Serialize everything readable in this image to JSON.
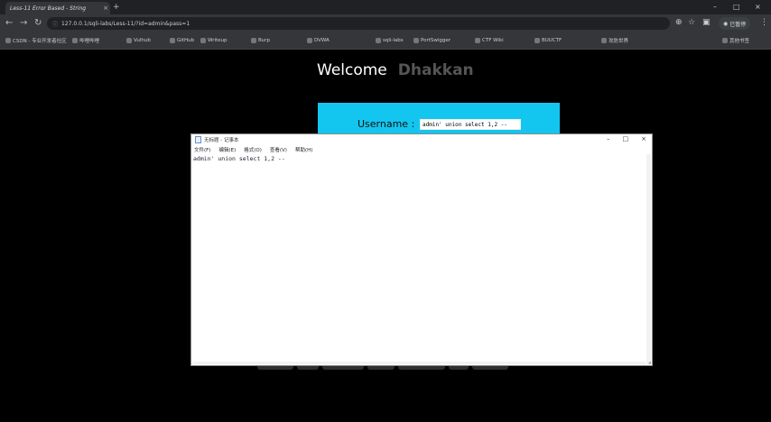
{
  "browser": {
    "tab_title": "Less-11 Error Based - String",
    "tab_close": "×",
    "new_tab": "+",
    "url": "127.0.0.1/sqli-labs/Less-11/?id=admin&pass=1",
    "profile_label": "已暂停",
    "win_controls": {
      "minimize": "–",
      "maximize": "□",
      "close": "×"
    },
    "bookmarks": [
      "CSDN - 专业开发者社区",
      "哔哩哔哩",
      "Vulhub",
      "GitHub",
      "Writeup",
      "Burp",
      "DVWA",
      "sqli-labs",
      "PortSwigger",
      "CTF Wiki",
      "BUUCTF",
      "攻防世界",
      "其他书签"
    ]
  },
  "page": {
    "welcome_label": "Welcome",
    "welcome_name": "Dhakkan",
    "username_label": "Username :",
    "username_value": "admin' union select 1,2 --"
  },
  "notepad": {
    "title": "无标题 - 记事本",
    "controls": {
      "minimize": "–",
      "maximize": "□",
      "close": "×"
    },
    "menu": [
      "文件(F)",
      "编辑(E)",
      "格式(O)",
      "查看(V)",
      "帮助(H)"
    ],
    "content": "admin' union select 1,2 --"
  }
}
